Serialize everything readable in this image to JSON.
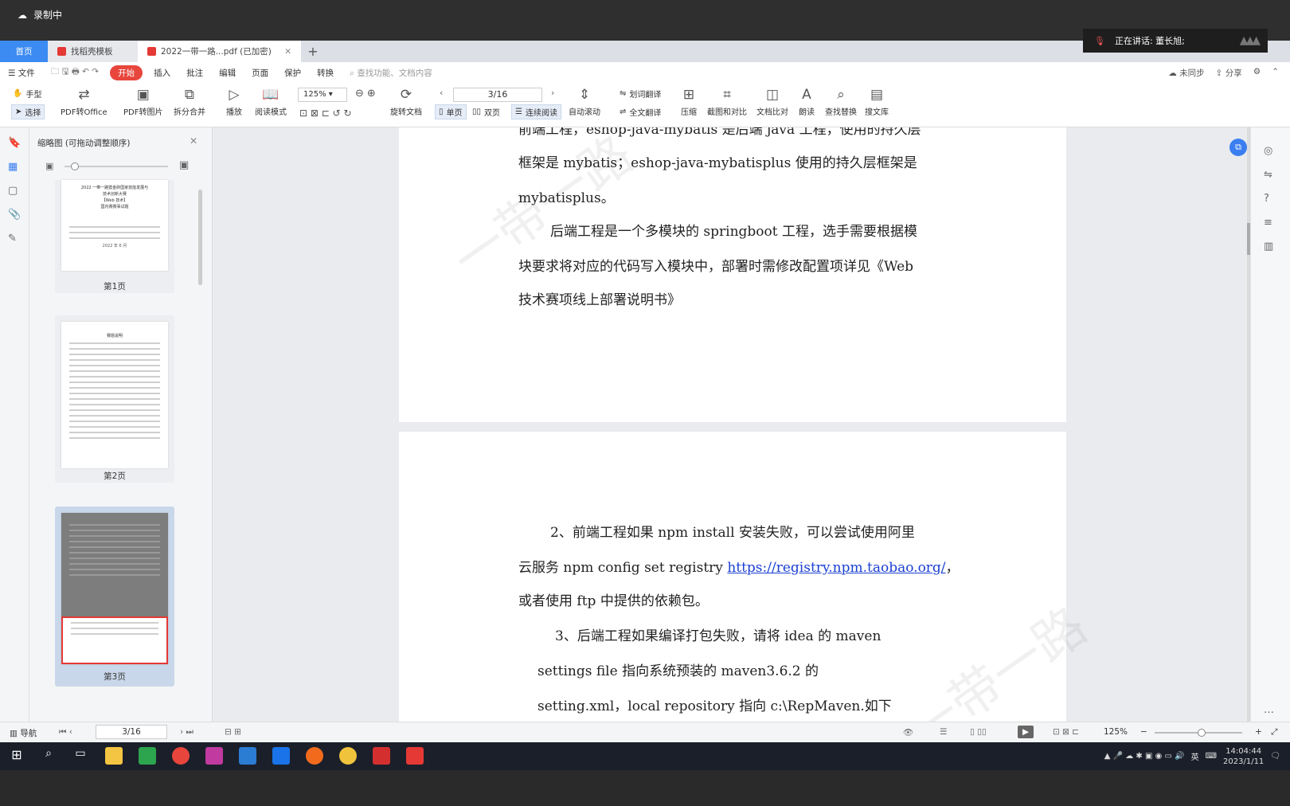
{
  "recorder": {
    "status": "录制中"
  },
  "speaking": {
    "label": "正在讲话: 董长旭;"
  },
  "tabs": [
    {
      "label": "首页"
    },
    {
      "label": "找稻壳模板"
    },
    {
      "label": "2022一带一路...pdf (已加密)"
    }
  ],
  "menu": {
    "file": "文件",
    "items": [
      "开始",
      "插入",
      "批注",
      "编辑",
      "页面",
      "保护",
      "转换"
    ],
    "search_placeholder": "查找功能、文档内容",
    "right": [
      "未同步",
      "分享"
    ]
  },
  "ribbon": {
    "hand": "手型",
    "select": "选择",
    "pdf_to_office": "PDF转Office",
    "pdf_to_image": "PDF转图片",
    "split_merge": "拆分合并",
    "play": "播放",
    "read_mode": "阅读模式",
    "zoom": "125%",
    "rotate_doc": "旋转文档",
    "page": "3/16",
    "single": "单页",
    "double": "双页",
    "continuous": "连续阅读",
    "auto_scroll": "自动滚动",
    "word_translate": "划词翻译",
    "full_translate": "全文翻译",
    "compress": "压缩",
    "screenshot": "截图和对比",
    "compare": "文档比对",
    "read_aloud": "朗读",
    "find_replace": "查找替换",
    "library": "搜文库"
  },
  "thumbnails": {
    "header": "缩略图 (可拖动调整顺序)",
    "pages": [
      {
        "label": "第1页",
        "lines": [
          "2022 一带一路暨金砖国家技能发展与",
          "技术创新大赛",
          "【Web 技术】",
          "国内赛赛事试题"
        ],
        "date": "2022 年 6 月"
      },
      {
        "label": "第2页",
        "title": "赛题说明"
      },
      {
        "label": "第3页"
      }
    ]
  },
  "document": {
    "page_top": {
      "line0": "前端工程，eshop-java-mybatis 是后端 java 工程，使用的持久层",
      "line1": "框架是 mybatis；eshop-java-mybatisplus 使用的持久层框架是",
      "line2": "mybatisplus。",
      "line3": "后端工程是一个多模块的 springboot 工程，选手需要根据模",
      "line4": "块要求将对应的代码写入模块中，部署时需修改配置项详见《Web",
      "line5": "技术赛项线上部署说明书》"
    },
    "page_bottom": {
      "p2a": "2、前端工程如果 npm install 安装失败，可以尝试使用阿里",
      "p2b_prefix": "云服务 npm config set registry ",
      "p2b_link": "https://registry.npm.taobao.org/",
      "p2b_suffix": "，",
      "p2c": "或者使用 ftp 中提供的依赖包。",
      "p3a": "3、后端工程如果编译打包失败，请将 idea 的 maven",
      "p3b": "settings file 指向系统预装的 maven3.6.2 的",
      "p3c": "setting.xml，local repository 指向 c:\\RepMaven.如下"
    },
    "watermark": "一带一路"
  },
  "statusbar": {
    "nav": "导航",
    "page": "3/16",
    "zoom": "125%"
  },
  "clock": {
    "time": "14:04:44",
    "date": "2023/1/11"
  },
  "tray_lang": "英"
}
